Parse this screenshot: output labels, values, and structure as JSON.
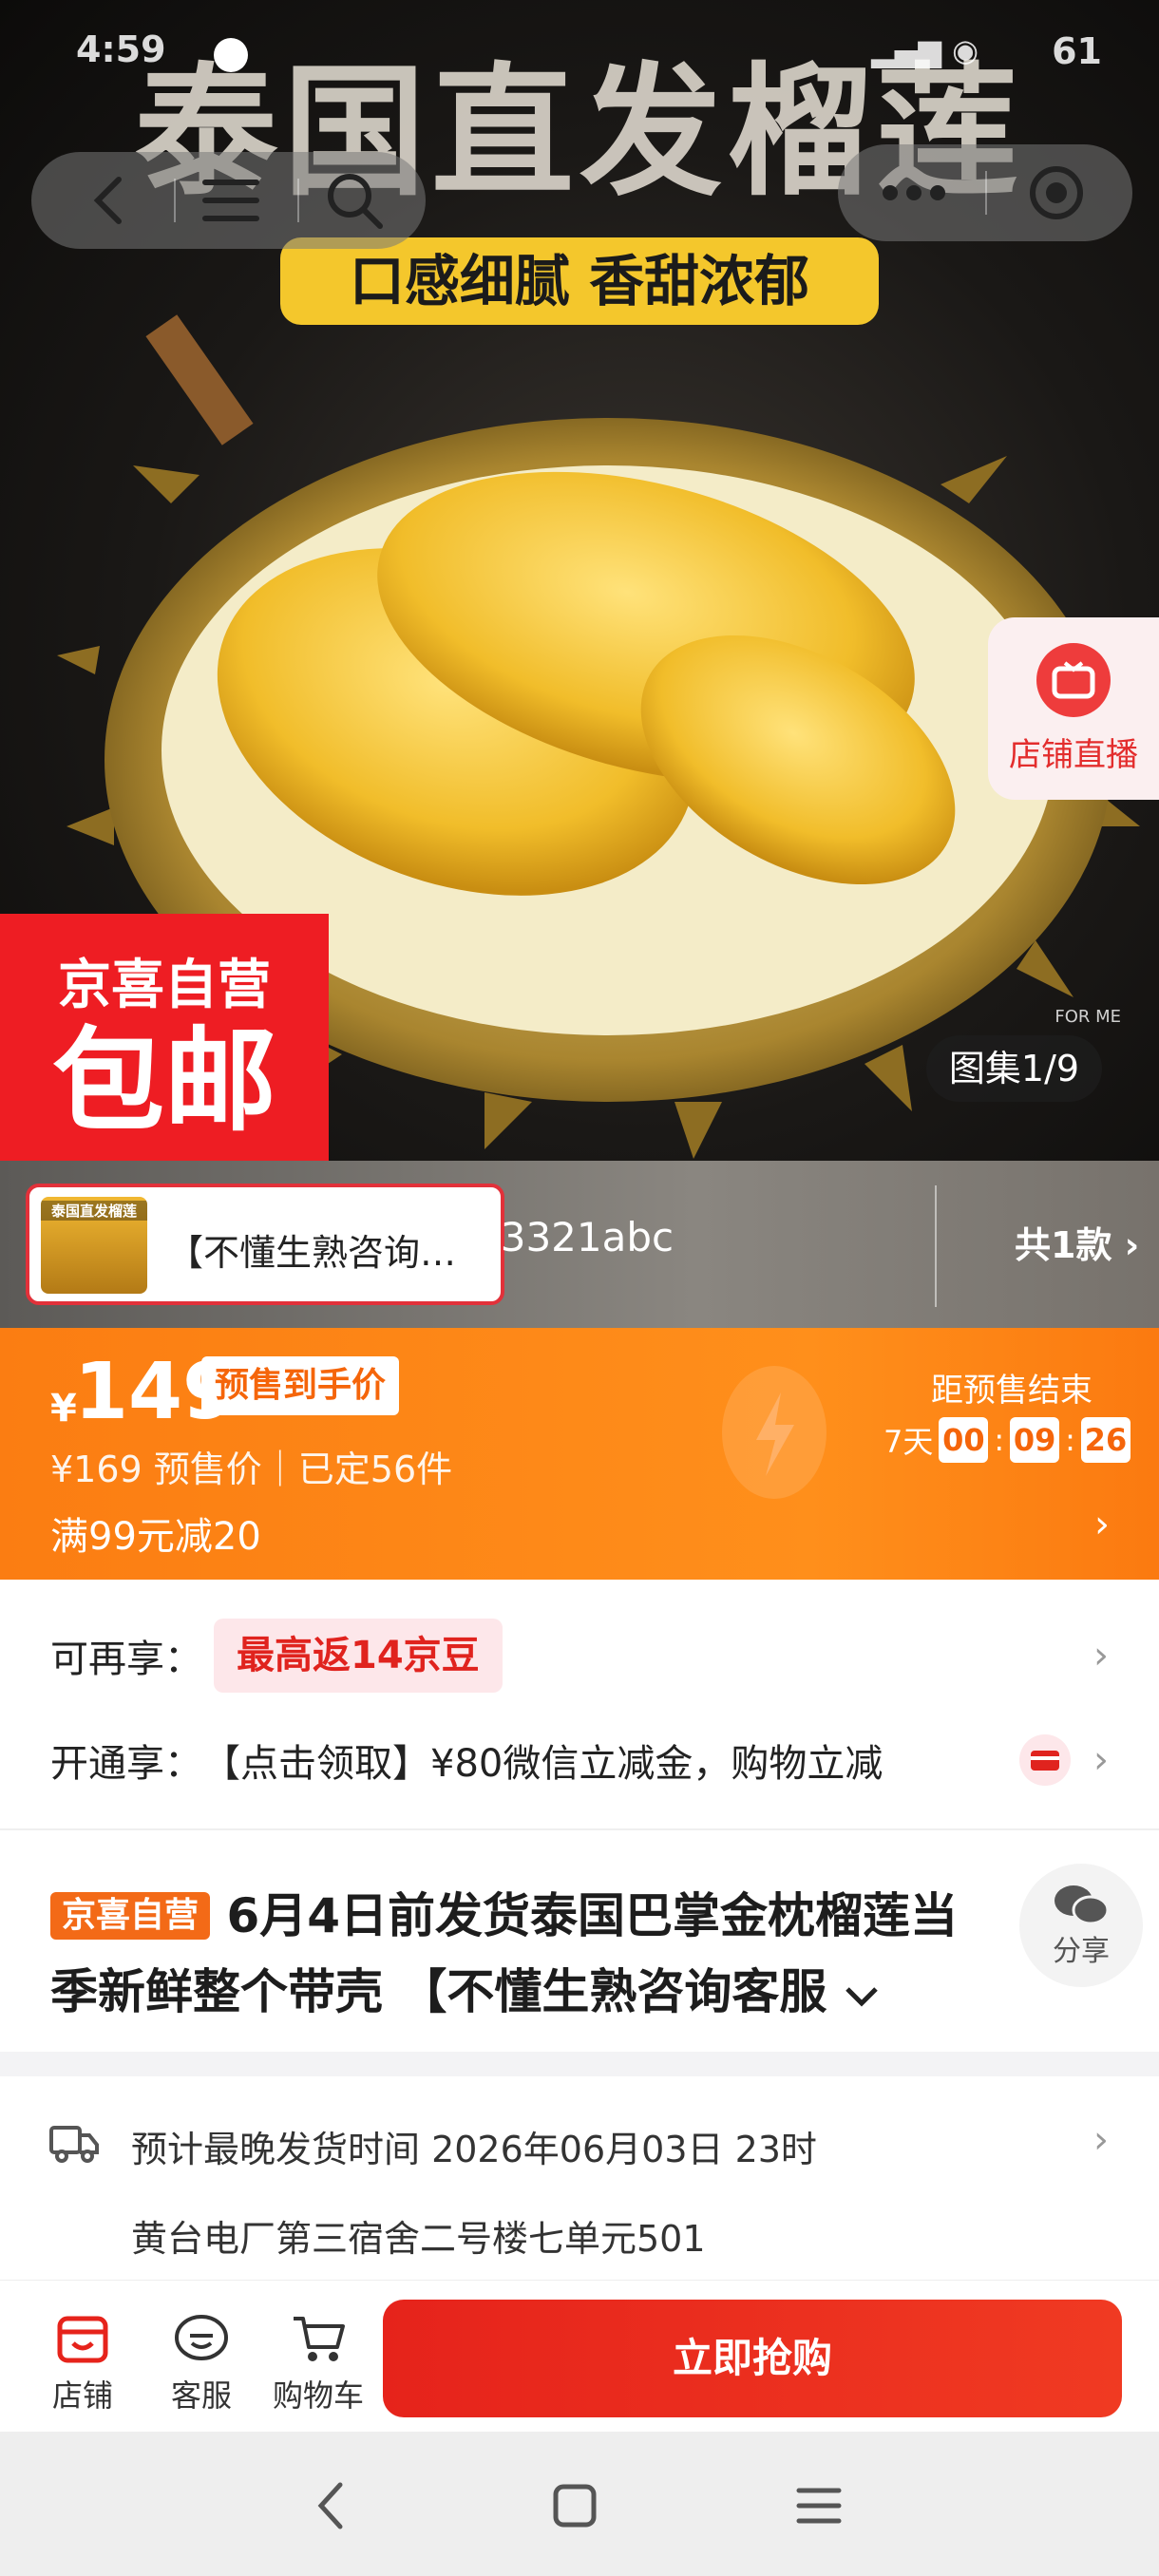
{
  "status_bar": {
    "time": "4:59",
    "battery": "61"
  },
  "hero": {
    "headline": "泰国直发榴莲",
    "subline": "口感细腻 香甜浓郁",
    "promo_line1": "京喜自营",
    "promo_line2": "包邮",
    "gallery_counter": "图集1/9",
    "watermark": "FOR ME",
    "live_label": "店铺直播"
  },
  "sku": {
    "thumb_text": "泰国直发榴莲",
    "name": "【不懂生熟咨询…",
    "code": "23321abc",
    "count_label": "共1款"
  },
  "price": {
    "symbol": "¥",
    "amount": "149",
    "tag": "预售到手价",
    "sub": "¥169 预售价｜已定56件",
    "coupon": "满99元减20",
    "countdown_label": "距预售结束",
    "days": "7天",
    "hh": "00",
    "mm": "09",
    "ss": "26"
  },
  "perks": {
    "row1_label": "可再享：",
    "row1_pill": "最高返14京豆",
    "row2_label": "开通享：",
    "row2_text": "【点击领取】¥80微信立减金，购物立减"
  },
  "product": {
    "self_tag": "京喜自营",
    "title": "6月4日前发货泰国巴掌金枕榴莲当季新鲜整个带壳 【不懂生熟咨询客服",
    "share_label": "分享"
  },
  "delivery": {
    "line1": "预计最晚发货时间 2026年06月03日 23时",
    "line2": "黄台电厂第三宿舍二号楼七单元501"
  },
  "action_bar": {
    "shop_label": "店铺",
    "service_label": "客服",
    "cart_label": "购物车",
    "buy_label": "立即抢购"
  },
  "colors": {
    "brand_red": "#e6231b",
    "price_orange": "#fb7d12",
    "tag_orange": "#f36a17"
  }
}
